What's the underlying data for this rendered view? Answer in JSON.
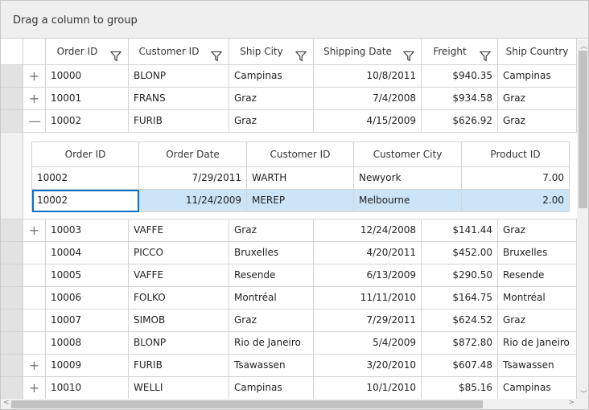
{
  "group_panel": {
    "text": "Drag a column to group"
  },
  "columns": [
    {
      "label": "Order ID",
      "filter": true
    },
    {
      "label": "Customer ID",
      "filter": true
    },
    {
      "label": "Ship City",
      "filter": true
    },
    {
      "label": "Shipping Date",
      "filter": true
    },
    {
      "label": "Freight",
      "filter": true
    },
    {
      "label": "Ship Country",
      "filter": false
    }
  ],
  "rows": [
    {
      "expander": "plus",
      "cells": [
        "10000",
        "BLONP",
        "Campinas",
        "10/8/2011",
        "$940.35",
        "Campinas"
      ]
    },
    {
      "expander": "plus",
      "cells": [
        "10001",
        "FRANS",
        "Graz",
        "7/4/2008",
        "$934.58",
        "Graz"
      ]
    },
    {
      "expander": "minus",
      "cells": [
        "10002",
        "FURIB",
        "Graz",
        "4/15/2009",
        "$626.92",
        "Graz"
      ]
    },
    {
      "expander": "plus",
      "cells": [
        "10003",
        "VAFFE",
        "Graz",
        "12/24/2008",
        "$141.44",
        "Graz"
      ]
    },
    {
      "expander": "",
      "cells": [
        "10004",
        "PICCO",
        "Bruxelles",
        "4/20/2011",
        "$452.00",
        "Bruxelles"
      ]
    },
    {
      "expander": "",
      "cells": [
        "10005",
        "VAFFE",
        "Resende",
        "6/13/2009",
        "$290.50",
        "Resende"
      ]
    },
    {
      "expander": "",
      "cells": [
        "10006",
        "FOLKO",
        "Montréal",
        "11/11/2010",
        "$164.75",
        "Montréal"
      ]
    },
    {
      "expander": "",
      "cells": [
        "10007",
        "SIMOB",
        "Graz",
        "7/29/2011",
        "$624.52",
        "Graz"
      ]
    },
    {
      "expander": "",
      "cells": [
        "10008",
        "BLONP",
        "Rio de Janeiro",
        "5/4/2009",
        "$872.80",
        "Rio de Janeiro"
      ]
    },
    {
      "expander": "plus",
      "cells": [
        "10009",
        "FURIB",
        "Tsawassen",
        "3/20/2010",
        "$607.48",
        "Tsawassen"
      ]
    },
    {
      "expander": "plus",
      "cells": [
        "10010",
        "WELLI",
        "Campinas",
        "10/1/2010",
        "$85.16",
        "Campinas"
      ]
    }
  ],
  "detail": {
    "columns": [
      "Order ID",
      "Order Date",
      "Customer ID",
      "Customer City",
      "Product ID"
    ],
    "rows": [
      {
        "cells": [
          "10002",
          "7/29/2011",
          "WARTH",
          "Newyork",
          "7.00"
        ],
        "selected": false
      },
      {
        "cells": [
          "10002",
          "11/24/2009",
          "MEREP",
          "Melbourne",
          "2.00"
        ],
        "selected": true
      }
    ]
  },
  "colors": {
    "selection": "#cce4f7",
    "current_cell_border": "#0a6fc4"
  }
}
